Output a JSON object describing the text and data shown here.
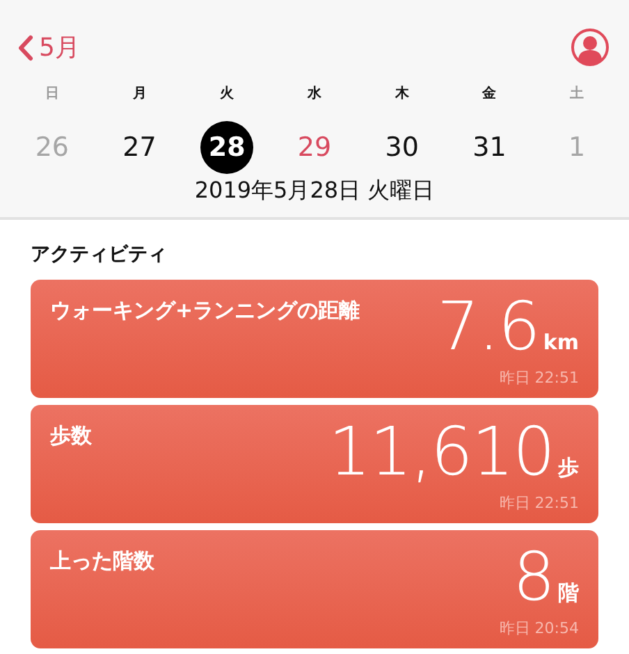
{
  "nav": {
    "back_label": "5月"
  },
  "week": [
    {
      "label": "日",
      "muted": true
    },
    {
      "label": "月",
      "muted": false
    },
    {
      "label": "火",
      "muted": false
    },
    {
      "label": "水",
      "muted": false
    },
    {
      "label": "木",
      "muted": false
    },
    {
      "label": "金",
      "muted": false
    },
    {
      "label": "土",
      "muted": true
    }
  ],
  "days": [
    {
      "day": "26",
      "kind": "other",
      "selected": false
    },
    {
      "day": "27",
      "kind": "normal",
      "selected": false
    },
    {
      "day": "28",
      "kind": "normal",
      "selected": true
    },
    {
      "day": "29",
      "kind": "today",
      "selected": false
    },
    {
      "day": "30",
      "kind": "normal",
      "selected": false
    },
    {
      "day": "31",
      "kind": "normal",
      "selected": false
    },
    {
      "day": "1",
      "kind": "other",
      "selected": false
    }
  ],
  "selected_date": "2019年5月28日 火曜日",
  "section_title": "アクティビティ",
  "cards": [
    {
      "label": "ウォーキング+ランニングの距離",
      "value": "7.6",
      "unit": "km",
      "time": "昨日 22:51"
    },
    {
      "label": "歩数",
      "value": "11,610",
      "unit": "歩",
      "time": "昨日 22:51"
    },
    {
      "label": "上った階数",
      "value": "8",
      "unit": "階",
      "time": "昨日 20:54"
    }
  ]
}
